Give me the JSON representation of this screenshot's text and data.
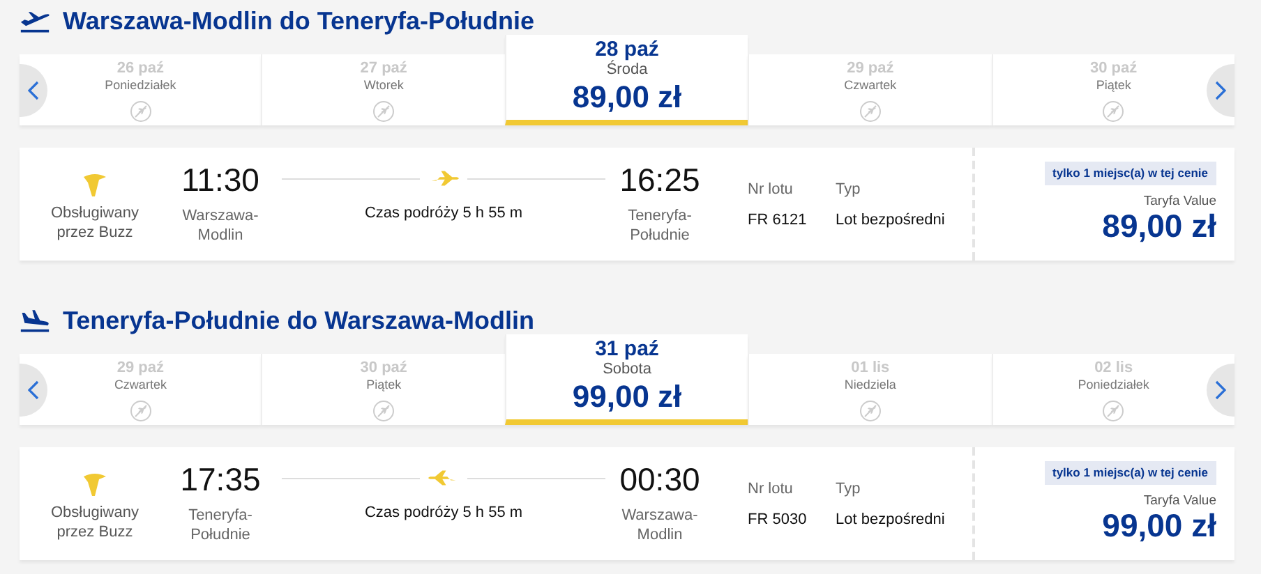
{
  "sections": [
    {
      "kind": "departure",
      "title": "Warszawa-Modlin do Teneryfa-Południe",
      "dates": [
        {
          "date": "26 paź",
          "day": "Poniedziałek",
          "selected": false
        },
        {
          "date": "27 paź",
          "day": "Wtorek",
          "selected": false
        },
        {
          "date": "28 paź",
          "day": "Środa",
          "price": "89,00 zł",
          "selected": true
        },
        {
          "date": "29 paź",
          "day": "Czwartek",
          "selected": false
        },
        {
          "date": "30 paź",
          "day": "Piątek",
          "selected": false
        }
      ],
      "flight": {
        "operator": "Obsługiwany przez Buzz",
        "dep_time": "11:30",
        "dep_airport": "Warszawa-Modlin",
        "duration": "Czas podróży 5 h 55 m",
        "arr_time": "16:25",
        "arr_airport": "Teneryfa-Południe",
        "flight_no_label": "Nr lotu",
        "flight_no": "FR 6121",
        "type_label": "Typ",
        "type": "Lot bezpośredni",
        "seats_badge": "tylko 1 miejsc(a) w tej cenie",
        "fare_label": "Taryfa Value",
        "price": "89,00 zł"
      }
    },
    {
      "kind": "arrival",
      "title": "Teneryfa-Południe do Warszawa-Modlin",
      "dates": [
        {
          "date": "29 paź",
          "day": "Czwartek",
          "selected": false
        },
        {
          "date": "30 paź",
          "day": "Piątek",
          "selected": false
        },
        {
          "date": "31 paź",
          "day": "Sobota",
          "price": "99,00 zł",
          "selected": true
        },
        {
          "date": "01 lis",
          "day": "Niedziela",
          "selected": false
        },
        {
          "date": "02 lis",
          "day": "Poniedziałek",
          "selected": false
        }
      ],
      "flight": {
        "operator": "Obsługiwany przez Buzz",
        "dep_time": "17:35",
        "dep_airport": "Teneryfa-Południe",
        "duration": "Czas podróży 5 h 55 m",
        "arr_time": "00:30",
        "arr_airport": "Warszawa-Modlin",
        "flight_no_label": "Nr lotu",
        "flight_no": "FR 5030",
        "type_label": "Typ",
        "type": "Lot bezpośredni",
        "seats_badge": "tylko 1 miejsc(a) w tej cenie",
        "fare_label": "Taryfa Value",
        "price": "99,00 zł"
      }
    }
  ]
}
